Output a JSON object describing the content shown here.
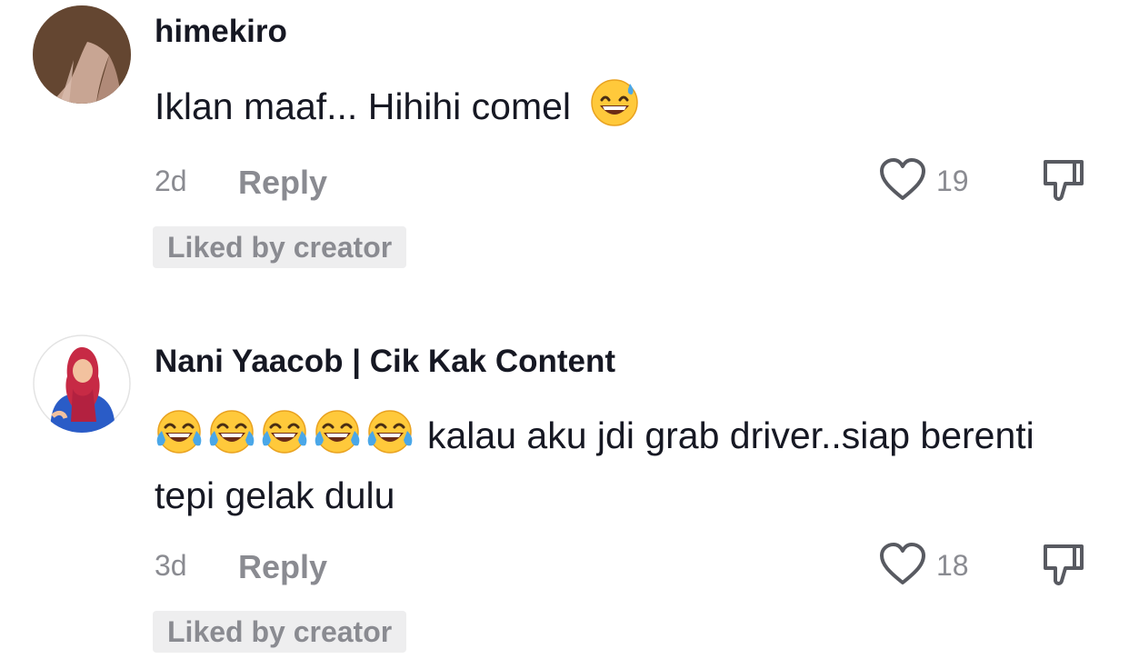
{
  "comments": [
    {
      "username": "himekiro",
      "text": "Iklan maaf... Hihihi comel",
      "emoji_after": "grinning-sweat-emoji",
      "time": "2d",
      "reply_label": "Reply",
      "like_count": "19",
      "badge": "Liked by creator"
    },
    {
      "username": "Nani Yaacob | Cik Kak Content",
      "emoji_before_count": 5,
      "emoji_before": "tears-of-joy-emoji",
      "text": "kalau aku jdi grab driver..siap berenti tepi gelak dulu",
      "time": "3d",
      "reply_label": "Reply",
      "like_count": "18",
      "badge": "Liked by creator"
    }
  ],
  "colors": {
    "text_primary": "#161823",
    "text_secondary": "#8a8b91",
    "badge_bg": "#eeeeef",
    "emoji_yellow": "#ffc93b",
    "emoji_tear": "#4aa7e8"
  }
}
